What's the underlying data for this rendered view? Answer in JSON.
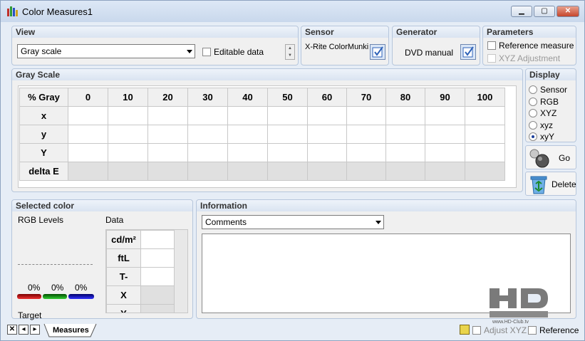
{
  "window": {
    "title": "Color Measures1"
  },
  "view": {
    "header": "View",
    "select_value": "Gray scale",
    "editable_label": "Editable data"
  },
  "sensor": {
    "header": "Sensor",
    "value": "X-Rite ColorMunki"
  },
  "generator": {
    "header": "Generator",
    "value": "DVD manual"
  },
  "parameters": {
    "header": "Parameters",
    "reference_measure": "Reference measure",
    "xyz_adjustment": "XYZ Adjustment"
  },
  "grayscale": {
    "header": "Gray Scale",
    "columns": [
      "% Gray",
      "0",
      "10",
      "20",
      "30",
      "40",
      "50",
      "60",
      "70",
      "80",
      "90",
      "100"
    ],
    "rows": [
      "x",
      "y",
      "Y",
      "delta E"
    ]
  },
  "display": {
    "header": "Display",
    "options": [
      "Sensor",
      "RGB",
      "XYZ",
      "xyz",
      "xyY"
    ],
    "selected": "xyY"
  },
  "actions": {
    "go": "Go",
    "delete": "Delete"
  },
  "selected_color": {
    "header": "Selected color",
    "rgb_levels": "RGB Levels",
    "data": "Data",
    "percents": [
      "0%",
      "0%",
      "0%"
    ],
    "target": "Target",
    "data_rows": [
      "cd/m²",
      "ftL",
      "T-",
      "X",
      "Y"
    ]
  },
  "information": {
    "header": "Information",
    "select_value": "Comments"
  },
  "bottom": {
    "tab": "Measures",
    "adjust_xyz": "Adjust XYZ",
    "reference": "Reference"
  },
  "watermark": {
    "logo": "HD CLUB",
    "url": "www.HD-Club.tv"
  },
  "colors": {
    "panel_header": "#dae4f1",
    "radio_selected": "#1a3e9a"
  }
}
